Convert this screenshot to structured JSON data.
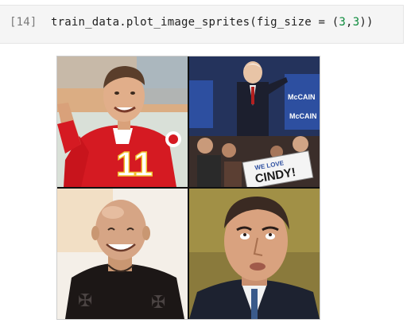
{
  "cell": {
    "prompt": "[14]",
    "code_prefix": "train_data.plot_image_sprites(fig_size = (",
    "arg_a": "3",
    "arg_sep": ",",
    "arg_b": "3",
    "code_suffix": "))"
  },
  "output": {
    "sprites": [
      {
        "subject": "football-player",
        "jersey_number": "11"
      },
      {
        "subject": "politician-at-rally",
        "sign_lines": [
          "WE LOVE",
          "CINDY!"
        ],
        "crowd_sign_text": "McCAIN"
      },
      {
        "subject": "bald-man-smiling"
      },
      {
        "subject": "man-in-suit"
      }
    ]
  }
}
